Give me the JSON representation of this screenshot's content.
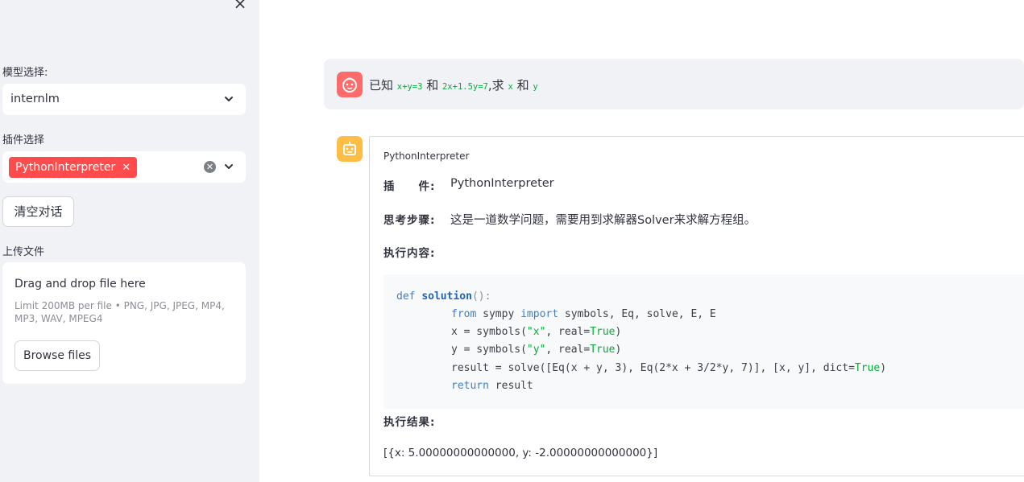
{
  "sidebar": {
    "close_icon": "close-icon",
    "model_label": "模型选择:",
    "model_value": "internlm",
    "plugin_label": "插件选择",
    "plugin_tag": "PythonInterpreter",
    "clear_button": "清空对话",
    "upload_label": "上传文件",
    "upload_title": "Drag and drop file here",
    "upload_limit": "Limit 200MB per file • PNG, JPG, JPEG, MP4, MP3, WAV, MPEG4",
    "browse_button": "Browse files"
  },
  "chat": {
    "user_message": {
      "prefix": "已知",
      "eq1": "x+y=3",
      "and1": "和",
      "eq2": "2x+1.5y=7",
      "mid": ",求",
      "var_x": "x",
      "and2": "和",
      "var_y": "y"
    },
    "assistant": {
      "title": "PythonInterpreter",
      "plugin_key": "插　　件:",
      "plugin_value": "PythonInterpreter",
      "thought_key": "思考步骤:",
      "thought_value": "这是一道数学问题，需要用到求解器Solver来求解方程组。",
      "exec_key": "执行内容:",
      "code": {
        "l1_def": "def",
        "l1_name": "solution",
        "l1_rest": "():",
        "l2_from": "from",
        "l2_mod": " sympy ",
        "l2_import": "import",
        "l2_rest": " symbols, Eq, solve, E, E",
        "l3_a": "x = symbols(",
        "l3_str": "\"x\"",
        "l3_b": ", real=",
        "l3_true": "True",
        "l3_c": ")",
        "l4_a": "y = symbols(",
        "l4_str": "\"y\"",
        "l4_b": ", real=",
        "l4_true": "True",
        "l4_c": ")",
        "l5_a": "result = solve([Eq(x + y, 3), Eq(2*x + 3/2*y, 7)], [x, y], dict=",
        "l5_true": "True",
        "l5_c": ")",
        "l6_ret": "return",
        "l6_rest": " result"
      },
      "result_key": "执行结果:",
      "result_value": "[{x: 5.00000000000000, y: -2.00000000000000}]"
    }
  },
  "colors": {
    "sidebar_bg": "#f0f2f6",
    "tag_red": "#ff4b4b",
    "user_avatar": "#ff6b6b",
    "assistant_avatar": "#ffbd45",
    "code_green": "#09ab3b"
  }
}
